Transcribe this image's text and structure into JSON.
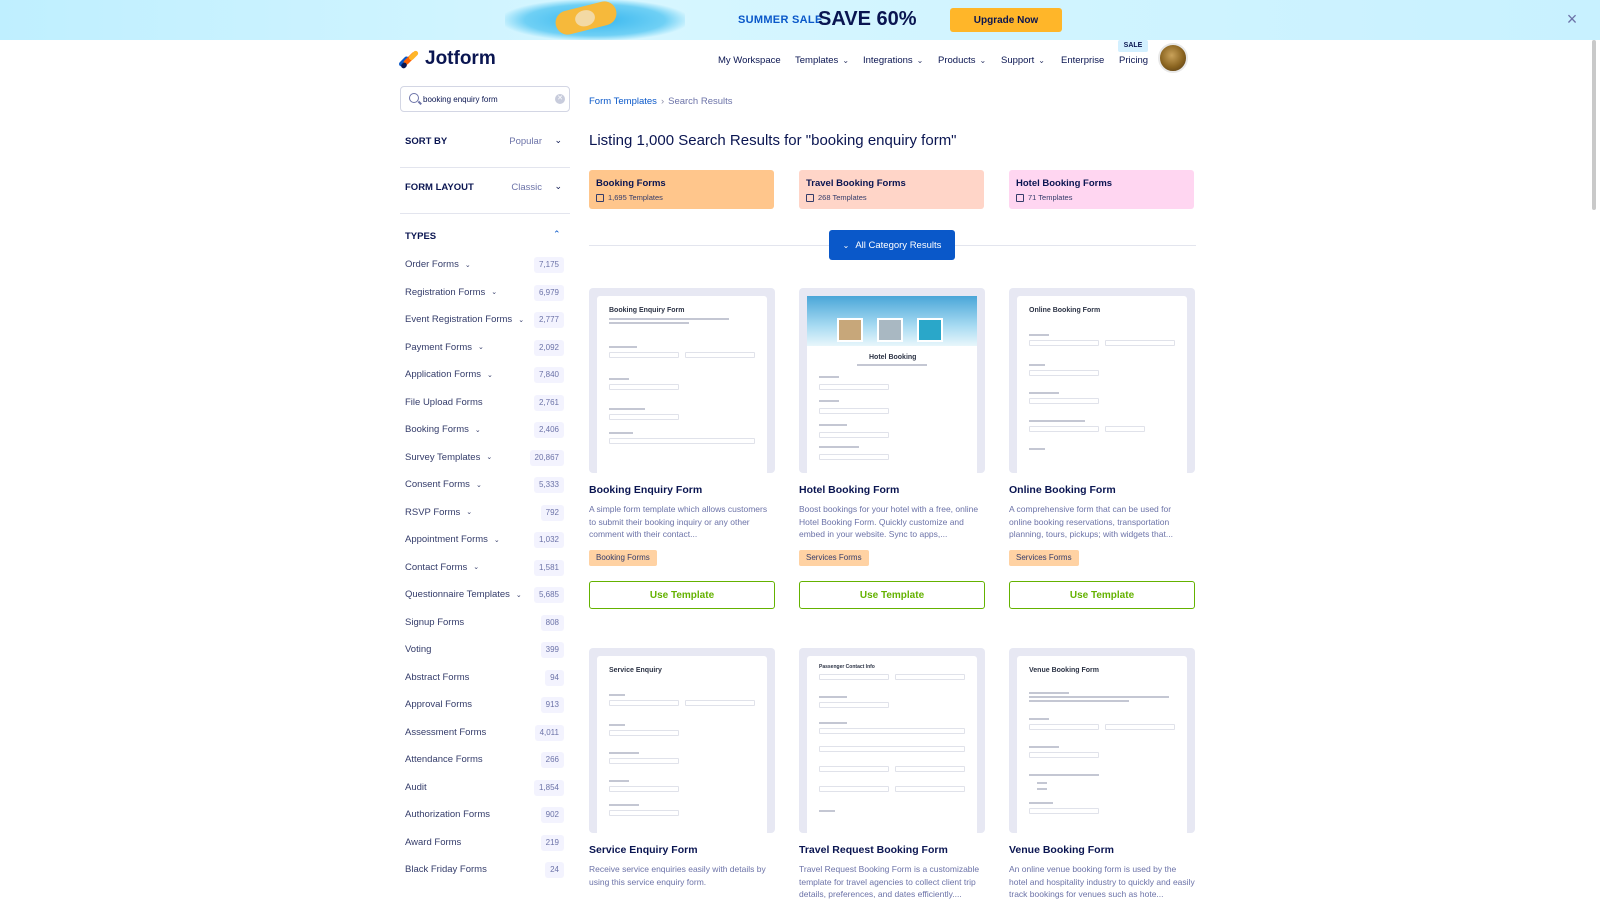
{
  "banner": {
    "label": "SUMMER SALE",
    "headline": "SAVE 60%",
    "cta": "Upgrade Now",
    "close": "×"
  },
  "nav": {
    "brand": "Jotform",
    "items": [
      {
        "label": "My Workspace",
        "dropdown": false
      },
      {
        "label": "Templates",
        "dropdown": true
      },
      {
        "label": "Integrations",
        "dropdown": true
      },
      {
        "label": "Products",
        "dropdown": true
      },
      {
        "label": "Support",
        "dropdown": true
      },
      {
        "label": "Enterprise",
        "dropdown": false
      },
      {
        "label": "Pricing",
        "dropdown": false
      }
    ],
    "sale_badge": "SALE"
  },
  "sidebar": {
    "search_value": "booking enquiry form",
    "sort_label": "SORT BY",
    "sort_value": "Popular",
    "layout_label": "FORM LAYOUT",
    "layout_value": "Classic",
    "types_label": "TYPES",
    "types": [
      {
        "name": "Order Forms",
        "count": "7,175",
        "expand": true
      },
      {
        "name": "Registration Forms",
        "count": "6,979",
        "expand": true
      },
      {
        "name": "Event Registration Forms",
        "count": "2,777",
        "expand": true
      },
      {
        "name": "Payment Forms",
        "count": "2,092",
        "expand": true
      },
      {
        "name": "Application Forms",
        "count": "7,840",
        "expand": true
      },
      {
        "name": "File Upload Forms",
        "count": "2,761",
        "expand": false
      },
      {
        "name": "Booking Forms",
        "count": "2,406",
        "expand": true
      },
      {
        "name": "Survey Templates",
        "count": "20,867",
        "expand": true
      },
      {
        "name": "Consent Forms",
        "count": "5,333",
        "expand": true
      },
      {
        "name": "RSVP Forms",
        "count": "792",
        "expand": true
      },
      {
        "name": "Appointment Forms",
        "count": "1,032",
        "expand": true
      },
      {
        "name": "Contact Forms",
        "count": "1,581",
        "expand": true
      },
      {
        "name": "Questionnaire Templates",
        "count": "5,685",
        "expand": true
      },
      {
        "name": "Signup Forms",
        "count": "808",
        "expand": false
      },
      {
        "name": "Voting",
        "count": "399",
        "expand": false
      },
      {
        "name": "Abstract Forms",
        "count": "94",
        "expand": false
      },
      {
        "name": "Approval Forms",
        "count": "913",
        "expand": false
      },
      {
        "name": "Assessment Forms",
        "count": "4,011",
        "expand": false
      },
      {
        "name": "Attendance Forms",
        "count": "266",
        "expand": false
      },
      {
        "name": "Audit",
        "count": "1,854",
        "expand": false
      },
      {
        "name": "Authorization Forms",
        "count": "902",
        "expand": false
      },
      {
        "name": "Award Forms",
        "count": "219",
        "expand": false
      },
      {
        "name": "Black Friday Forms",
        "count": "24",
        "expand": false
      }
    ]
  },
  "main": {
    "breadcrumb_root": "Form Templates",
    "breadcrumb_sep": "›",
    "breadcrumb_current": "Search Results",
    "heading": "Listing 1,000 Search Results for \"booking enquiry form\"",
    "categories": [
      {
        "title": "Booking Forms",
        "count": "1,695 Templates",
        "color": "#ffc68c"
      },
      {
        "title": "Travel Booking Forms",
        "count": "268 Templates",
        "color": "#ffd5c8"
      },
      {
        "title": "Hotel Booking Forms",
        "count": "71 Templates",
        "color": "#ffd6f1"
      }
    ],
    "all_category": "All Category Results",
    "cards": [
      {
        "thumb_title": "Booking Enquiry Form",
        "title": "Booking Enquiry Form",
        "desc": "A simple form template which allows customers to submit their booking inquiry or any other comment with their contact...",
        "tag": "Booking Forms",
        "button": "Use Template"
      },
      {
        "thumb_title": "Hotel Booking",
        "title": "Hotel Booking Form",
        "desc": "Boost bookings for your hotel with a free, online Hotel Booking Form. Quickly customize and embed in your website. Sync to apps,...",
        "tag": "Services Forms",
        "button": "Use Template"
      },
      {
        "thumb_title": "Online Booking Form",
        "title": "Online Booking Form",
        "desc": "A comprehensive form that can be used for online booking reservations, transportation planning, tours, pickups; with widgets that...",
        "tag": "Services Forms",
        "button": "Use Template"
      },
      {
        "thumb_title": "Service Enquiry",
        "title": "Service Enquiry Form",
        "desc": "Receive service enquiries easily with details by using this service enquiry form.",
        "tag": "",
        "button": ""
      },
      {
        "thumb_title": "Passenger Contact Info",
        "title": "Travel Request Booking Form",
        "desc": "Travel Request Booking Form is a customizable template for travel agencies to collect client trip details, preferences, and dates efficiently....",
        "tag": "",
        "button": ""
      },
      {
        "thumb_title": "Venue Booking Form",
        "title": "Venue Booking Form",
        "desc": "An online venue booking form is used by the hotel and hospitality industry to quickly and easily track bookings for venues such as hote...",
        "tag": "",
        "button": ""
      }
    ]
  },
  "colors": {
    "primary": "#0a58c9",
    "navy": "#0a1551",
    "green": "#64b200",
    "sale": "#ffb629",
    "tag": "#ffd2a3"
  }
}
